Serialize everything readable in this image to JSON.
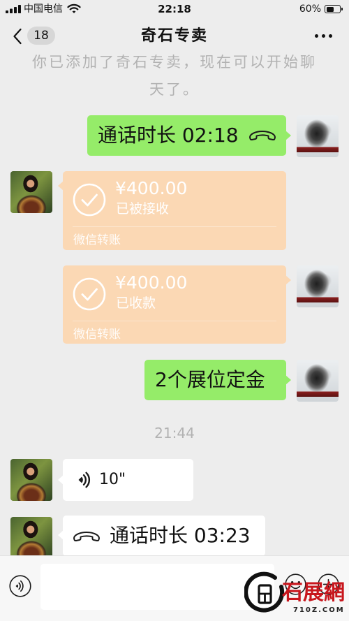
{
  "status_bar": {
    "carrier": "中国电信",
    "time": "22:18",
    "battery": "60%",
    "battery_level": 0.6,
    "icons": [
      "signal-bars-icon",
      "wifi-icon",
      "battery-icon"
    ]
  },
  "nav": {
    "unread_badge": "18",
    "title": "奇石专卖",
    "back_icon": "chevron-left-icon",
    "more_icon": "more-dots-icon"
  },
  "system_notice": "你已添加了奇石专卖，现在可以开始聊天了。",
  "messages": [
    {
      "outgoing": true,
      "icon": "phone-icon",
      "text": "通话时长 02:18"
    },
    {
      "outgoing": false,
      "icon": "check-circle-icon",
      "amount": "¥400.00",
      "status": "已被接收",
      "label": "微信转账"
    },
    {
      "outgoing": true,
      "icon": "check-circle-icon",
      "amount": "¥400.00",
      "status": "已收款",
      "label": "微信转账"
    },
    {
      "outgoing": true,
      "text": "2个展位定金"
    },
    {
      "outgoing": false,
      "icon": "voice-icon",
      "duration": "10\""
    },
    {
      "outgoing": false,
      "icon": "phone-icon",
      "text": "通话时长 03:23"
    }
  ],
  "time_divider": "21:44",
  "input_bar": {
    "value": "",
    "icons": [
      "voice-toggle-icon",
      "emoji-icon",
      "plus-icon"
    ]
  },
  "watermark": {
    "brand": "石展網",
    "domain": "710Z.COM"
  },
  "colors": {
    "background": "#ededed",
    "bubble_outgoing": "#95ec69",
    "bubble_incoming": "#ffffff",
    "transfer_card": "#fbd8b4",
    "watermark_red": "#c8161d",
    "muted_text": "#b2b2b2"
  }
}
